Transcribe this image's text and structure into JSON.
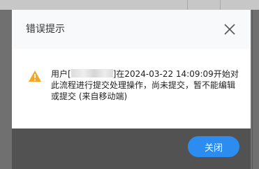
{
  "dialog": {
    "title": "错误提示",
    "message_prefix": "用户[",
    "message_suffix": "]在2024-03-22 14:09:09开始对此流程进行提交处理操作，尚未提交，暂不能编辑或提交 (来自移动端)",
    "close_button_label": "关闭",
    "accent_color": "#2d8cf0",
    "warning_color": "#f5a623",
    "icons": {
      "warning": "warning-triangle-icon",
      "close": "close-icon"
    }
  }
}
